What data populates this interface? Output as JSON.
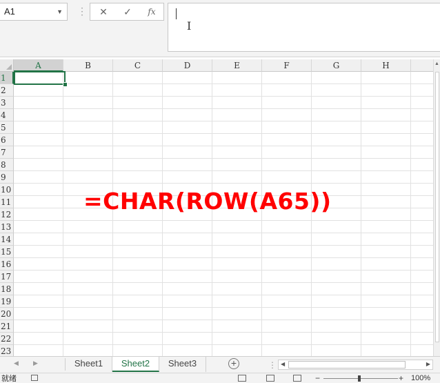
{
  "formula_bar": {
    "name_box": "A1",
    "cancel_icon": "✕",
    "enter_icon": "✓",
    "fx_label": "fx",
    "formula_value": ""
  },
  "grid": {
    "columns": [
      "A",
      "B",
      "C",
      "D",
      "E",
      "F",
      "G",
      "H"
    ],
    "rows": [
      "1",
      "2",
      "3",
      "4",
      "5",
      "6",
      "7",
      "8",
      "9",
      "10",
      "11",
      "12",
      "13",
      "14",
      "15",
      "16",
      "17",
      "18",
      "19",
      "20",
      "21",
      "22",
      "23"
    ],
    "selected_cell": "A1"
  },
  "overlay": {
    "formula_text": "=CHAR(ROW(A65))",
    "color": "#ff0000"
  },
  "sheets": {
    "tabs": [
      "Sheet1",
      "Sheet2",
      "Sheet3"
    ],
    "active": "Sheet2"
  },
  "status": {
    "mode": "就绪",
    "zoom": "100%"
  },
  "colors": {
    "accent": "#217346",
    "header_bg": "#f0f0f0",
    "gridline": "#e1e1e1"
  }
}
